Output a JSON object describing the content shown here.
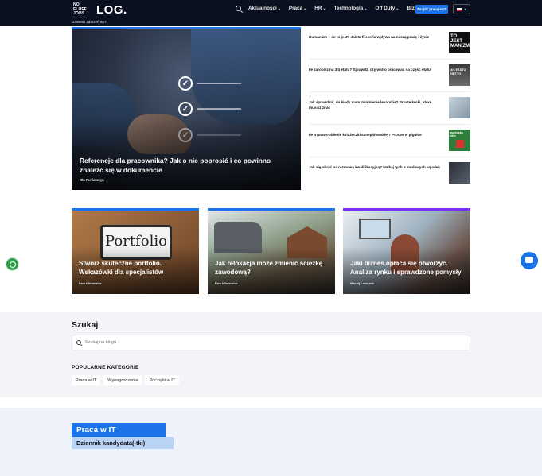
{
  "header": {
    "logo_small": [
      "NO",
      "FLUFF",
      "JOBS"
    ],
    "logo_main": "LOG.",
    "subtitle": "Dziennik zdarzeń w IT",
    "nav": [
      {
        "label": "Aktualności",
        "chevron": "⌄"
      },
      {
        "label": "Praca",
        "chevron": "⌄"
      },
      {
        "label": "HR",
        "chevron": "⌄"
      },
      {
        "label": "Technologia",
        "chevron": "⌄"
      },
      {
        "label": "Off Duty",
        "chevron": "⌄"
      },
      {
        "label": "Biznes",
        "chevron": "⌄"
      }
    ],
    "cta_label": "Znajdź pracę w IT",
    "language_flag": "pl-flag-icon",
    "accent_color": "#1a73e8"
  },
  "hero": {
    "title": "Referencje dla pracownika? Jak o nie poprosić i co powinno znaleźć się w dokumencie",
    "author": "Ola Perliczszyn"
  },
  "side_articles": [
    {
      "title": "Humanizm – co to jest? Jak ta filozofia wpływa na naszą pracę i życie",
      "thumb_text": "TO JEST MANIZM"
    },
    {
      "title": "Ile zarobisz na 3/4 etatu? Sprawdź, czy warto pracować na część etatu",
      "thumb_text": "3/4 ETATU NETTO"
    },
    {
      "title": "Jak sprawdzić, do kiedy mam zwolnienie lekarskie? Proste kroki, które musisz znać",
      "thumb_text": ""
    },
    {
      "title": "Ile trwa wyrobienie książeczki sanepidowskiej? Proces w pigułce",
      "thumb_text": "siążeczka zdro"
    },
    {
      "title": "Jak się ubrać na rozmowę kwalifikacyjną? Unikaj tych 5 modowych wpadek",
      "thumb_text": ""
    }
  ],
  "cards": [
    {
      "title": "Stwórz skuteczne portfolio. Wskazówki dla specjalistów",
      "author": "Ewa Klimowicz",
      "bar_color": "#1a73e8",
      "image_text": "Portfolio"
    },
    {
      "title": "Jak relokacja może zmienić ścieżkę zawodową?",
      "author": "Ewa Klimowicz",
      "bar_color": "#1a73e8"
    },
    {
      "title": "Jaki biznes opłaca się otworzyć. Analiza rynku i sprawdzone pomysły",
      "author": "Maciej Lewczak",
      "bar_color": "#7b2ff7"
    }
  ],
  "search": {
    "heading": "Szukaj",
    "placeholder": "Szukaj na blogu"
  },
  "categories": {
    "heading": "POPULARNE KATEGORIE",
    "items": [
      "Praca w IT",
      "Wynagrodzenie",
      "Początki w IT"
    ]
  },
  "footer_block": {
    "primary": "Praca w IT",
    "secondary": "Dziennik kandydata(-tki)"
  }
}
